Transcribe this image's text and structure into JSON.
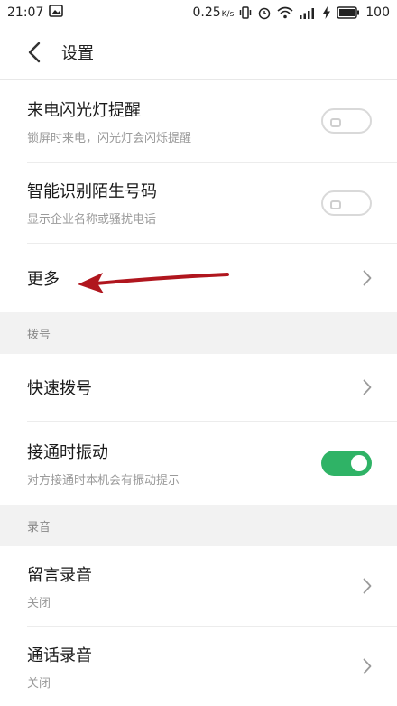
{
  "status": {
    "time": "21:07",
    "speed": "0.25",
    "speed_unit": "K/s",
    "battery": "100"
  },
  "header": {
    "title": "设置"
  },
  "items": {
    "flash": {
      "title": "来电闪光灯提醒",
      "sub": "锁屏时来电，闪光灯会闪烁提醒",
      "toggle": "off"
    },
    "identify": {
      "title": "智能识别陌生号码",
      "sub": "显示企业名称或骚扰电话",
      "toggle": "off"
    },
    "more": {
      "title": "更多"
    }
  },
  "sections": {
    "dial": {
      "label": "拨号",
      "quick": {
        "title": "快速拨号"
      },
      "vibrate": {
        "title": "接通时振动",
        "sub": "对方接通时本机会有振动提示",
        "toggle": "on"
      }
    },
    "record": {
      "label": "录音",
      "voicemail": {
        "title": "留言录音",
        "sub": "关闭"
      },
      "call": {
        "title": "通话录音",
        "sub": "关闭"
      }
    }
  },
  "colors": {
    "toggle_on": "#2fb366",
    "annotation_arrow": "#b0161e",
    "section_bg": "#f2f2f2"
  }
}
